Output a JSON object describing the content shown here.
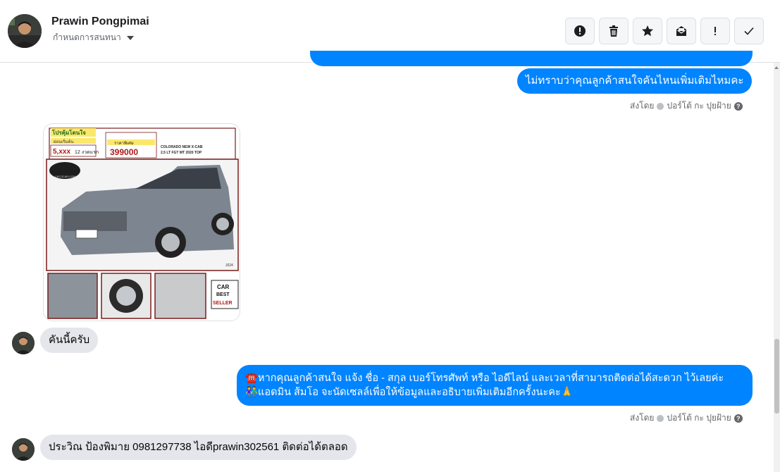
{
  "header": {
    "contact_name": "Prawin Pongpimai",
    "chat_settings_label": "กำหนดการสนทนา",
    "actions": [
      {
        "name": "report-button",
        "icon": "alert-icon"
      },
      {
        "name": "delete-button",
        "icon": "trash-icon"
      },
      {
        "name": "star-button",
        "icon": "star-icon"
      },
      {
        "name": "mark-unread-button",
        "icon": "envelope-icon"
      },
      {
        "name": "important-button",
        "icon": "exclamation-icon"
      },
      {
        "name": "done-button",
        "icon": "check-icon"
      }
    ]
  },
  "messages": {
    "m1_text": "ไม่ทราบว่าคุณลูกค้าสนใจคันไหนเพิ่มเติมไหมคะ",
    "m1_sent_by": "ส่งโดย",
    "m1_sender": "ปอร์โต้ กะ ปุยฝ้าย",
    "car_ad": {
      "promo": "โปรคุ้มโดนใจ",
      "down_label": "ผ่อนเริ่มต้น",
      "down_value": "5,xxx",
      "installment": "12 งวดแรก",
      "price_label": "ราคาพิเศษ",
      "price": "399000",
      "model_line1": "COLORADO NEW X-CAB",
      "model_line2": "2.5 LT FGT MT 2020 TOP",
      "site": "CKC2CAR.COM",
      "badge_line1": "CAR",
      "badge_line2": "BEST",
      "badge_line3": "SELLER",
      "code": "J024"
    },
    "m2_text": "คันนี้ครับ",
    "m3_line1": "☎️หากคุณลูกค้าสนใจ แจ้ง ชื่อ - สกุล เบอร์โทรศัพท์ หรือ ไอดีไลน์ และเวลาที่สามารถติดต่อได้สะดวก ไว้เลยค่ะ",
    "m3_line2": "👫แอดมิน ส้มโอ จะนัดเซลล์เพื่อให้ข้อมูลและอธิบายเพิ่มเติมอีกครั้งนะคะ🙏",
    "m3_sent_by": "ส่งโดย",
    "m3_sender": "ปอร์โต้ กะ ปุยฝ้าย",
    "m4_text": "ประวิณ ป้องพิมาย 0981297738  ไอดีprawin302561 ติดต่อได้ตลอด"
  },
  "colors": {
    "outgoing_bubble": "#0084ff",
    "incoming_bubble": "#e4e6eb"
  }
}
